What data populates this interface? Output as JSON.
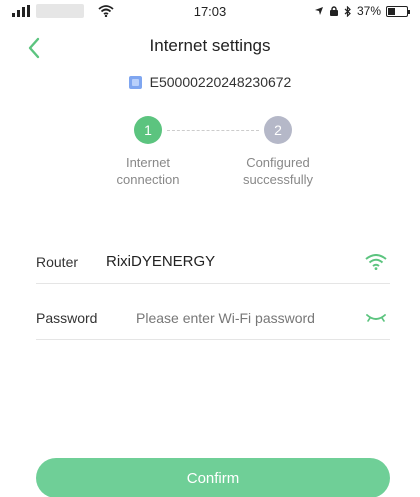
{
  "status_bar": {
    "time": "17:03",
    "battery_text": "37%",
    "battery_level": 0.37
  },
  "header": {
    "title": "Internet settings"
  },
  "device": {
    "id": "E50000220248230672"
  },
  "steps": [
    {
      "number": "1",
      "label_line1": "Internet",
      "label_line2": "connection"
    },
    {
      "number": "2",
      "label_line1": "Configured",
      "label_line2": "successfully"
    }
  ],
  "form": {
    "router_label": "Router",
    "router_value": "RixiDYENERGY",
    "password_label": "Password",
    "password_placeholder": "Please enter Wi-Fi password",
    "password_value": ""
  },
  "actions": {
    "confirm_label": "Confirm"
  },
  "colors": {
    "accent": "#5cc47f",
    "confirm_bg": "#6fcf97",
    "step_inactive": "#b5b8c8"
  },
  "icons": {
    "back": "chevron-left-icon",
    "wifi": "wifi-icon",
    "eye": "eye-closed-icon"
  }
}
